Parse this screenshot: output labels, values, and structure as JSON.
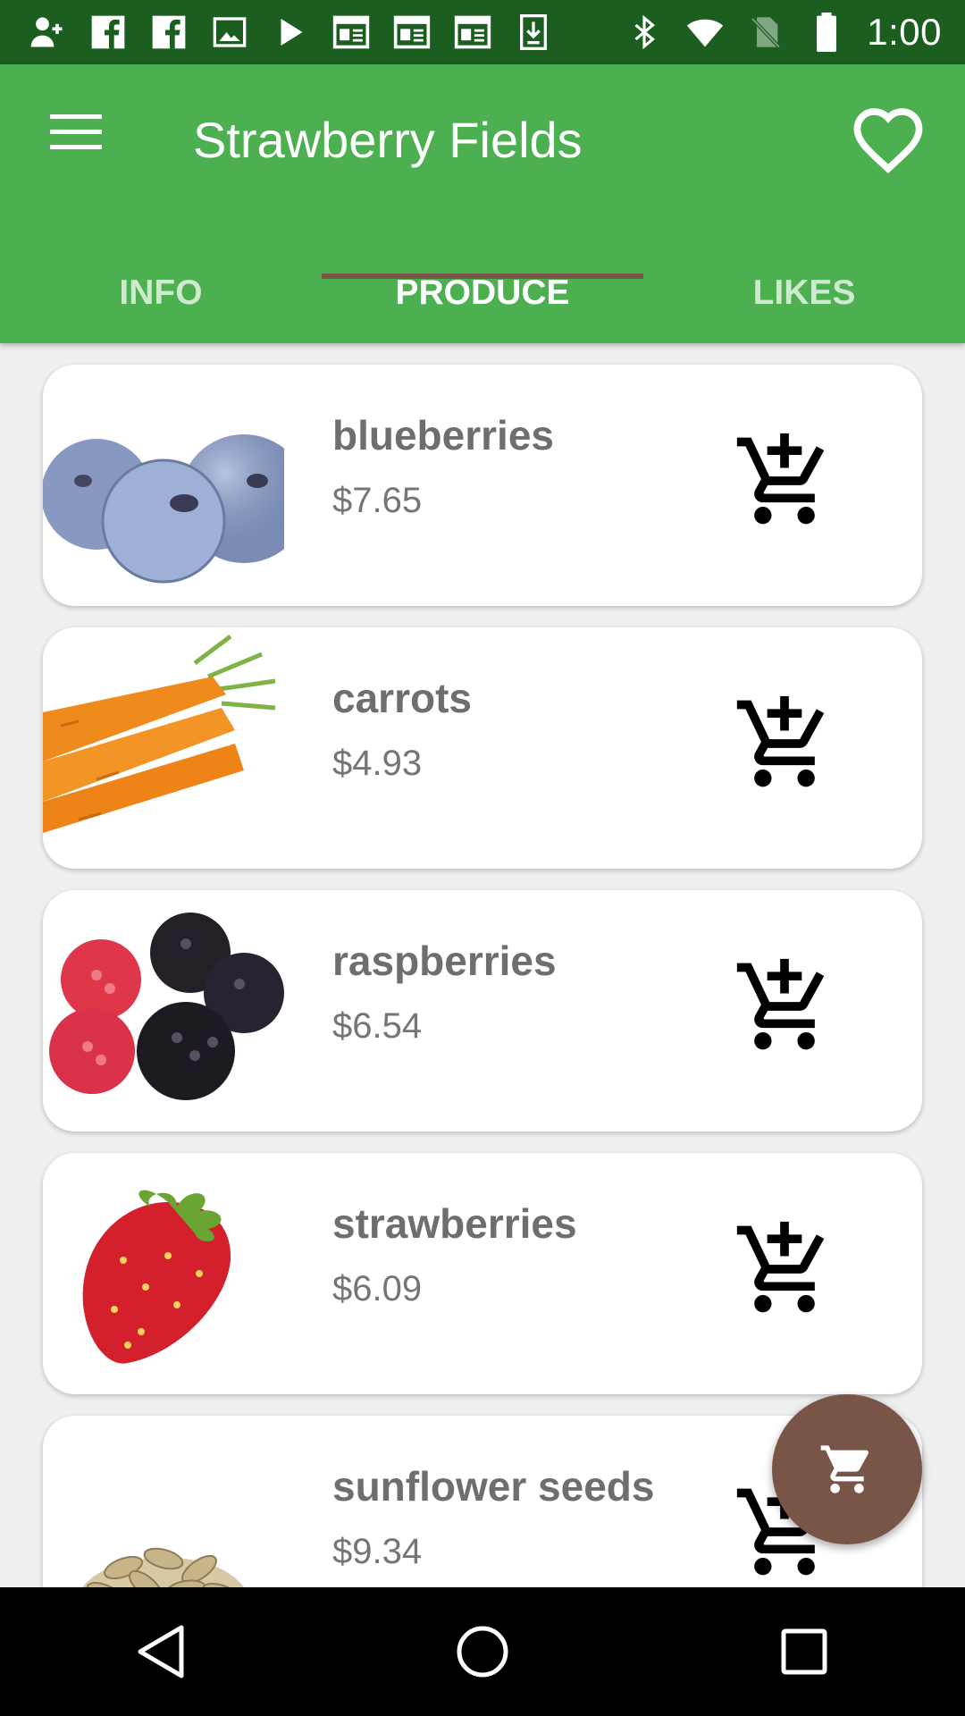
{
  "status_bar": {
    "time": "1:00",
    "left_icons": [
      "add-contact-icon",
      "facebook-icon",
      "facebook-icon",
      "image-icon",
      "play-store-icon",
      "news-icon",
      "news-icon",
      "news-icon",
      "download-icon"
    ],
    "right_icons": [
      "bluetooth-icon",
      "wifi-icon",
      "no-sim-icon",
      "battery-icon"
    ]
  },
  "app_bar": {
    "title": "Strawberry Fields",
    "background_color": "#4caf50",
    "tabs": [
      {
        "label": "INFO",
        "active": false
      },
      {
        "label": "PRODUCE",
        "active": true
      },
      {
        "label": "LIKES",
        "active": false
      }
    ],
    "indicator_color": "#795548"
  },
  "products": [
    {
      "name": "blueberries",
      "price": "$7.65",
      "image": "blueberries-photo"
    },
    {
      "name": "carrots",
      "price": "$4.93",
      "image": "carrots-photo"
    },
    {
      "name": "raspberries",
      "price": "$6.54",
      "image": "raspberries-photo"
    },
    {
      "name": "strawberries",
      "price": "$6.09",
      "image": "strawberry-photo"
    },
    {
      "name": "sunflower seeds",
      "price": "$9.34",
      "image": "sunflower-seeds-photo"
    }
  ],
  "fab": {
    "icon": "shopping-cart-icon",
    "color": "#795548"
  },
  "nav_bar": {
    "icons": [
      "back-icon",
      "home-icon",
      "recents-icon"
    ]
  }
}
